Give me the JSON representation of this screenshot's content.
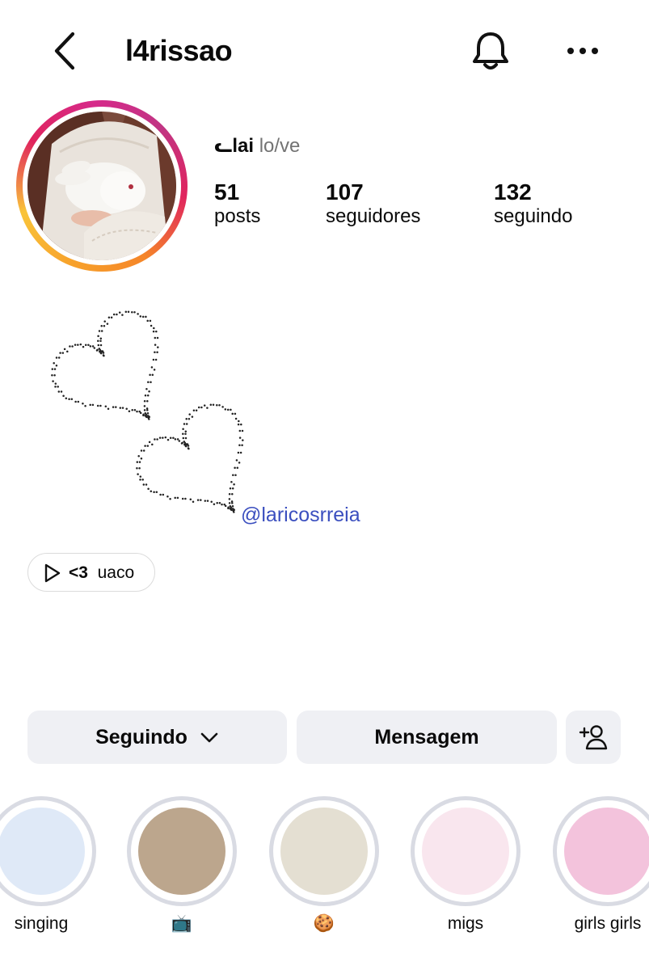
{
  "header": {
    "username": "l4rissao",
    "back_icon": "chevron-left-icon",
    "notification_icon": "bell-icon",
    "more_icon": "more-horizontal-icon"
  },
  "profile": {
    "display_name": "ᓚlai",
    "pronouns": "lo/ve",
    "avatar_description_icon": "avatar-photo"
  },
  "stats": [
    {
      "value": "51",
      "label": "posts"
    },
    {
      "value": "107",
      "label": "seguidores"
    },
    {
      "value": "132",
      "label": "seguindo"
    }
  ],
  "bio": {
    "mention": "@laricosrreia"
  },
  "reel_chip": {
    "bold": "<3",
    "text": "uaco"
  },
  "actions": {
    "following_label": "Seguindo",
    "message_label": "Mensagem"
  },
  "highlights": [
    {
      "label": "singing",
      "color": "#dfe9f7"
    },
    {
      "label": "📺",
      "color": "#bca68d"
    },
    {
      "label": "🍪",
      "color": "#e4dfd2"
    },
    {
      "label": "migs",
      "color": "#f9e6ee"
    },
    {
      "label": "girls girls",
      "color": "#f3c3dc"
    }
  ],
  "colors": {
    "mention": "#3b4fbf",
    "button_bg": "#eff0f4",
    "secondary_text": "#737373"
  }
}
